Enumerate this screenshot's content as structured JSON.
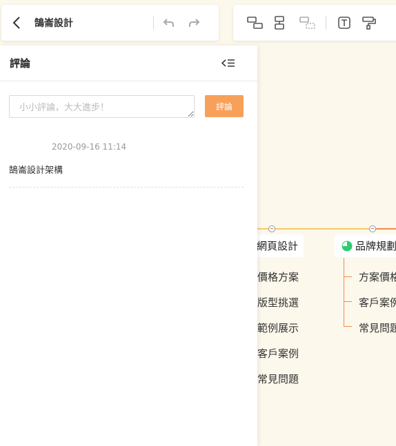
{
  "header": {
    "doc_title": "鵠崙設計"
  },
  "panel": {
    "title": "評論",
    "input_placeholder": "小小評論，大大進步！",
    "input_value": "",
    "submit_label": "評論",
    "comments": [
      {
        "time": "2020-09-16 11:14",
        "text": "鵠崙設計架構"
      }
    ]
  },
  "mindmap": {
    "branches": [
      {
        "title": "網頁設計",
        "children": [
          "價格方案",
          "版型挑選",
          "範例展示",
          "客戶案例",
          "常見問題"
        ]
      },
      {
        "title": "品牌規劃",
        "children": [
          "方案價格",
          "客戶案例",
          "常見問題"
        ]
      }
    ],
    "colors": {
      "line_yellow": "#f6c96a",
      "line_orange": "#f08a4b",
      "progress_green": "#2ecc71"
    }
  }
}
